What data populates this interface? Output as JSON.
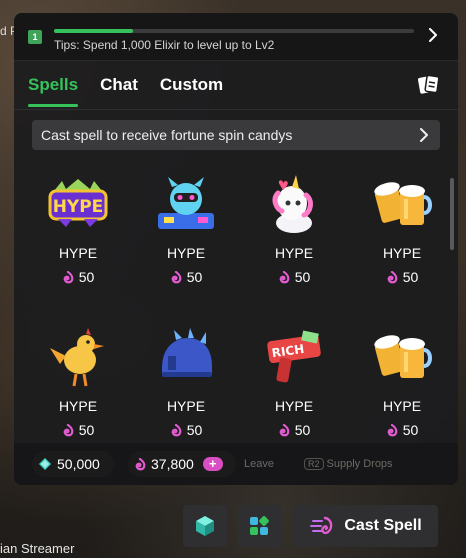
{
  "background": {
    "streamer_top": "d Pl",
    "streamer_bottom": "ian Streamer"
  },
  "tipbar": {
    "level_badge": "1",
    "progress": 0.22,
    "tip_text": "Tips: Spend 1,000 Elixir to level up to Lv2",
    "chevron_icon": "chevron-right-icon"
  },
  "tabs": [
    {
      "label": "Spells",
      "active": true
    },
    {
      "label": "Chat",
      "active": false
    },
    {
      "label": "Custom",
      "active": false
    }
  ],
  "tab_icon": "cards-icon",
  "banner": {
    "text": "Cast spell to receive fortune spin candys",
    "chevron_icon": "chevron-right-icon"
  },
  "spells": [
    {
      "name": "HYPE",
      "price": "50",
      "icon": "hype-logo-icon"
    },
    {
      "name": "HYPE",
      "price": "50",
      "icon": "dj-robot-icon"
    },
    {
      "name": "HYPE",
      "price": "50",
      "icon": "unicorn-icon"
    },
    {
      "name": "HYPE",
      "price": "50",
      "icon": "beer-mugs-icon"
    },
    {
      "name": "HYPE",
      "price": "50",
      "icon": "chicken-icon"
    },
    {
      "name": "HYPE",
      "price": "50",
      "icon": "spiked-helmet-icon"
    },
    {
      "name": "HYPE",
      "price": "50",
      "icon": "rich-money-gun-icon"
    },
    {
      "name": "HYPE",
      "price": "50",
      "icon": "beer-mugs-icon"
    }
  ],
  "currency": {
    "gems": "50,000",
    "candy": "37,800",
    "plus_label": "+"
  },
  "hints": {
    "leave": "Leave",
    "supply_key": "R2",
    "supply": "Supply Drops"
  },
  "actions": {
    "cast_label": "Cast Spell"
  },
  "colors": {
    "accent_green": "#35c25a",
    "candy_pink": "#d94ec3",
    "gem_teal": "#3fd3c0"
  }
}
